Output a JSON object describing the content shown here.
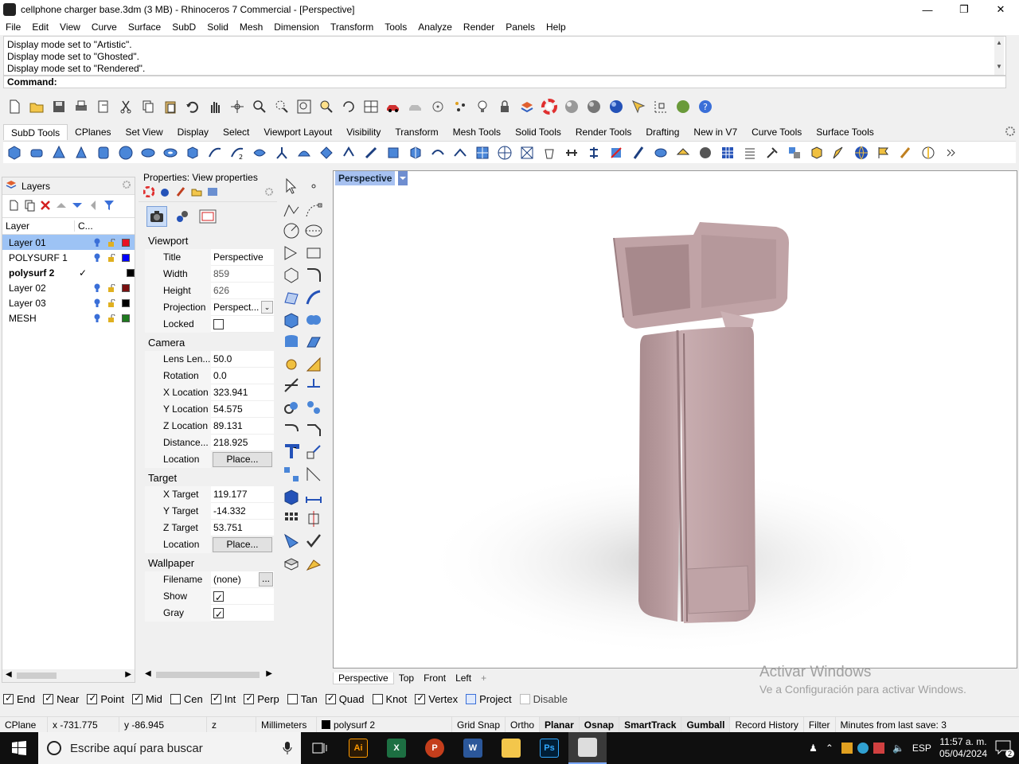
{
  "window": {
    "title": "cellphone charger base.3dm (3 MB) - Rhinoceros 7 Commercial - [Perspective]"
  },
  "menu": [
    "File",
    "Edit",
    "View",
    "Curve",
    "Surface",
    "SubD",
    "Solid",
    "Mesh",
    "Dimension",
    "Transform",
    "Tools",
    "Analyze",
    "Render",
    "Panels",
    "Help"
  ],
  "command": {
    "history": [
      "Display mode set to \"Artistic\".",
      "Display mode set to \"Ghosted\".",
      "Display mode set to \"Rendered\"."
    ],
    "prompt": "Command:"
  },
  "toolbar_tabs": [
    "SubD Tools",
    "CPlanes",
    "Set View",
    "Display",
    "Select",
    "Viewport Layout",
    "Visibility",
    "Transform",
    "Mesh Tools",
    "Solid Tools",
    "Render Tools",
    "Drafting",
    "New in V7",
    "Curve Tools",
    "Surface Tools"
  ],
  "layers": {
    "title": "Layers",
    "col_layer": "Layer",
    "col_current": "C...",
    "rows": [
      {
        "name": "Layer 01",
        "selected": true,
        "current": false,
        "color": "#e81123"
      },
      {
        "name": "POLYSURF 1",
        "selected": false,
        "current": false,
        "color": "#0000ff"
      },
      {
        "name": "polysurf 2",
        "selected": false,
        "current": true,
        "color": "#000000"
      },
      {
        "name": "Layer 02",
        "selected": false,
        "current": false,
        "color": "#7a1010"
      },
      {
        "name": "Layer 03",
        "selected": false,
        "current": false,
        "color": "#000000"
      },
      {
        "name": "MESH",
        "selected": false,
        "current": false,
        "color": "#1e7a1e"
      }
    ],
    "current_mark": "✓"
  },
  "properties": {
    "header": "Properties: View properties",
    "viewport_section": "Viewport",
    "title_label": "Title",
    "title_value": "Perspective",
    "width_label": "Width",
    "width_value": "859",
    "height_label": "Height",
    "height_value": "626",
    "projection_label": "Projection",
    "projection_value": "Perspect...",
    "locked_label": "Locked",
    "camera_section": "Camera",
    "lens_label": "Lens Len...",
    "lens_value": "50.0",
    "rotation_label": "Rotation",
    "rotation_value": "0.0",
    "xloc_label": "X Location",
    "xloc_value": "323.941",
    "yloc_label": "Y Location",
    "yloc_value": "54.575",
    "zloc_label": "Z Location",
    "zloc_value": "89.131",
    "distance_label": "Distance...",
    "distance_value": "218.925",
    "location_label": "Location",
    "place_button": "Place...",
    "target_section": "Target",
    "xt_label": "X Target",
    "xt_value": "119.177",
    "yt_label": "Y Target",
    "yt_value": "-14.332",
    "zt_label": "Z Target",
    "zt_value": "53.751",
    "tloc_label": "Location",
    "wallpaper_section": "Wallpaper",
    "filename_label": "Filename",
    "filename_value": "(none)",
    "browse": "...",
    "show_label": "Show",
    "gray_label": "Gray"
  },
  "viewport": {
    "title": "Perspective"
  },
  "viewport_tabs": [
    "Perspective",
    "Top",
    "Front",
    "Left",
    "+"
  ],
  "watermark": {
    "line1": "Activar Windows",
    "line2": "Ve a Configuración para activar Windows."
  },
  "osnap": {
    "items": [
      {
        "label": "End",
        "on": true
      },
      {
        "label": "Near",
        "on": true
      },
      {
        "label": "Point",
        "on": true
      },
      {
        "label": "Mid",
        "on": true
      },
      {
        "label": "Cen",
        "on": false
      },
      {
        "label": "Int",
        "on": true
      },
      {
        "label": "Perp",
        "on": true
      },
      {
        "label": "Tan",
        "on": false
      },
      {
        "label": "Quad",
        "on": true
      },
      {
        "label": "Knot",
        "on": false
      },
      {
        "label": "Vertex",
        "on": true
      }
    ],
    "project": "Project",
    "disable": "Disable"
  },
  "status": {
    "cplane": "CPlane",
    "x": "x -731.775",
    "y": "y -86.945",
    "z": "z",
    "units": "Millimeters",
    "layer": "polysurf 2",
    "grid_snap": "Grid Snap",
    "ortho": "Ortho",
    "planar": "Planar",
    "osnap": "Osnap",
    "smarttrack": "SmartTrack",
    "gumball": "Gumball",
    "record_history": "Record History",
    "filter": "Filter",
    "last_save": "Minutes from last save: 3"
  },
  "taskbar": {
    "search_placeholder": "Escribe aquí para buscar",
    "lang": "ESP",
    "time": "11:57 a. m.",
    "date": "05/04/2024",
    "notifications": "2"
  },
  "colors": {
    "accent": "#a7c1f0",
    "selection": "#9dc3f5",
    "model": "#b99a9c"
  }
}
